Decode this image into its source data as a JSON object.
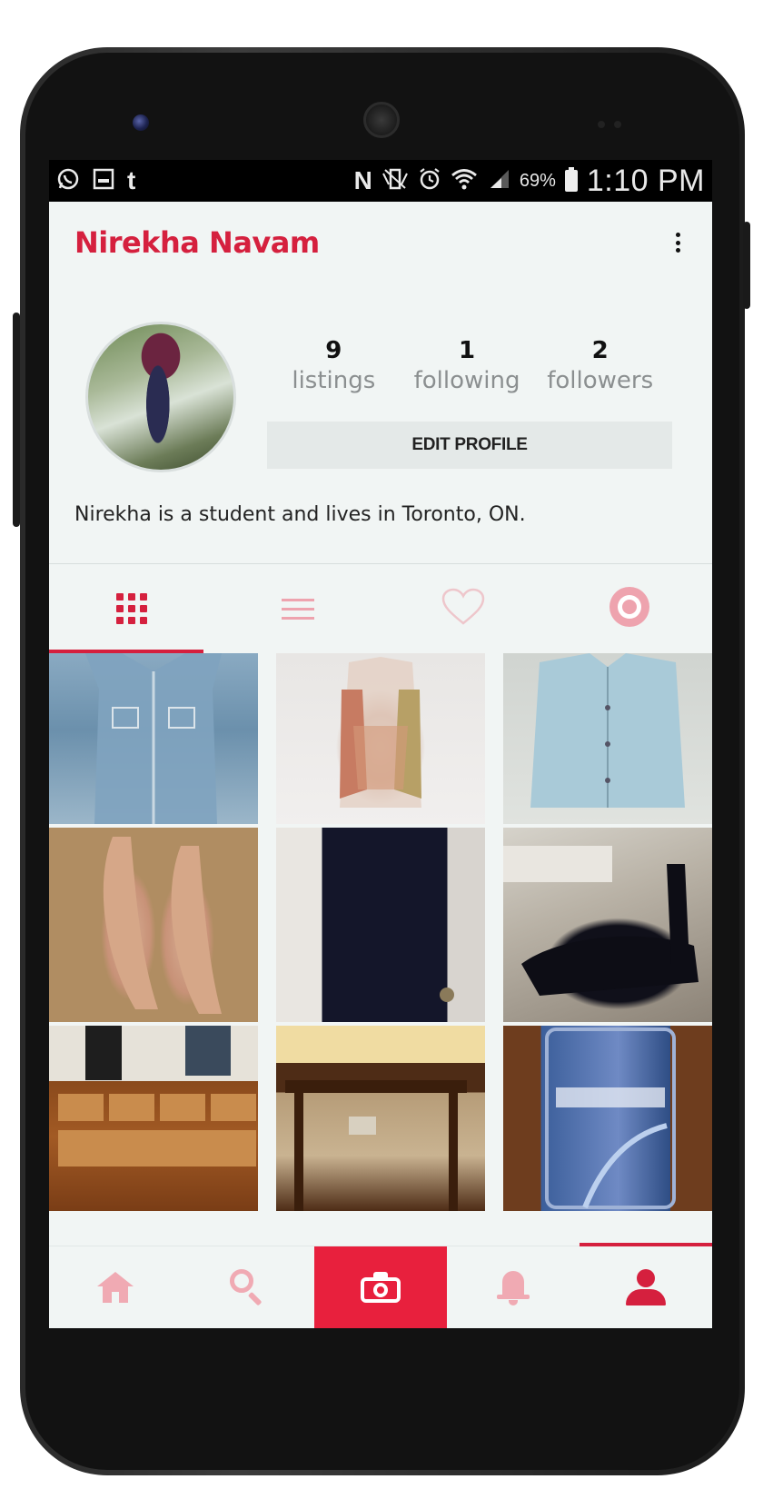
{
  "status_bar": {
    "left_icons": [
      "whatsapp-icon",
      "gallery-icon",
      "tumblr-icon"
    ],
    "tumblr_glyph": "t",
    "nfc_glyph": "N",
    "battery": "69%",
    "time": "1:10 PM"
  },
  "header": {
    "title": "Nirekha Navam"
  },
  "profile": {
    "stats": [
      {
        "count": "9",
        "label": "listings"
      },
      {
        "count": "1",
        "label": "following"
      },
      {
        "count": "2",
        "label": "followers"
      }
    ],
    "edit_button": "EDIT PROFILE",
    "bio": "Nirekha is a student and lives in Toronto, ON."
  },
  "tabs": [
    {
      "icon": "grid-icon",
      "active": true
    },
    {
      "icon": "list-icon",
      "active": false
    },
    {
      "icon": "heart-icon",
      "active": false
    },
    {
      "icon": "target-icon",
      "active": false
    }
  ],
  "photos": [
    "denim-sleeveless-shirt",
    "floral-vest-top",
    "light-blue-sleeveless-blouse",
    "nude-heels",
    "black-maxi-dress",
    "black-heels",
    "wooden-dresser",
    "wooden-side-table",
    "smartphone"
  ],
  "bottom_nav": [
    {
      "icon": "home-icon",
      "active": false
    },
    {
      "icon": "search-icon",
      "active": false
    },
    {
      "icon": "camera-icon",
      "active": false
    },
    {
      "icon": "bell-icon",
      "active": false
    },
    {
      "icon": "person-icon",
      "active": true
    }
  ],
  "colors": {
    "accent": "#d5203e",
    "accent_light": "#f0aab3",
    "camera_button": "#e8203d",
    "screen_bg": "#f1f5f4"
  }
}
